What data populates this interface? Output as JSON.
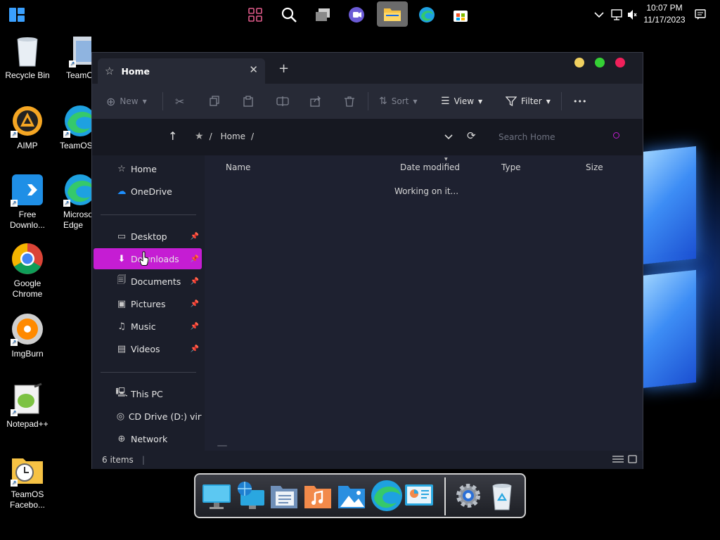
{
  "topbar": {
    "taskbar_icons": [
      "start-icon",
      "widgets-icon",
      "search-icon",
      "task-view-icon",
      "chat-icon",
      "file-explorer-icon",
      "edge-icon",
      "store-icon"
    ],
    "clock_time": "10:07 PM",
    "clock_date": "11/17/2023"
  },
  "desktop": {
    "icons": [
      {
        "label": "Recycle Bin",
        "icon": "recycle-bin-icon"
      },
      {
        "label": "TeamO",
        "icon": "teamos-icon"
      },
      {
        "label": "AIMP",
        "icon": "aimp-icon"
      },
      {
        "label": "TeamOS",
        "icon": "teamos-edge-icon"
      },
      {
        "label": "Free Downlo...",
        "icon": "free-download-manager-icon"
      },
      {
        "label": "Microso Edge",
        "icon": "edge-icon"
      },
      {
        "label": "Google Chrome",
        "icon": "chrome-icon"
      },
      {
        "label": "ImgBurn",
        "icon": "imgburn-icon"
      },
      {
        "label": "Notepad++",
        "icon": "notepadpp-icon"
      },
      {
        "label": "TeamOS Facebo...",
        "icon": "folder-clock-icon"
      }
    ]
  },
  "explorer": {
    "tab_title": "Home",
    "new_tab_glyph": "+",
    "toolbar": {
      "new_label": "New",
      "sort_label": "Sort",
      "view_label": "View",
      "filter_label": "Filter",
      "more_glyph": "•••"
    },
    "breadcrumb": {
      "root_glyph": "/",
      "location": "Home",
      "trailing_sep": "/"
    },
    "search_placeholder": "Search Home",
    "nav": {
      "top": [
        {
          "label": "Home",
          "icon": "star-icon"
        },
        {
          "label": "OneDrive",
          "icon": "cloud-icon"
        }
      ],
      "pinned": [
        {
          "label": "Desktop",
          "icon": "desktop-icon"
        },
        {
          "label": "Downloads",
          "icon": "download-icon"
        },
        {
          "label": "Documents",
          "icon": "documents-icon"
        },
        {
          "label": "Pictures",
          "icon": "pictures-icon"
        },
        {
          "label": "Music",
          "icon": "music-icon"
        },
        {
          "label": "Videos",
          "icon": "videos-icon"
        }
      ],
      "bottom": [
        {
          "label": "This PC",
          "icon": "pc-icon"
        },
        {
          "label": "CD Drive (D:) virtio-",
          "icon": "cd-drive-icon"
        },
        {
          "label": "Network",
          "icon": "network-icon"
        }
      ],
      "selected": "Downloads"
    },
    "columns": [
      "Name",
      "Date modified",
      "Type",
      "Size"
    ],
    "status_message": "Working on it...",
    "status_bar": {
      "item_count": "6 items",
      "separator": "|"
    },
    "colors": {
      "selected": "#c51dd3",
      "minimize": "#f0d060",
      "maximize": "#35d035",
      "close": "#f0205a"
    }
  },
  "dock": {
    "items": [
      "monitor-icon",
      "network-globe-icon",
      "files-icon",
      "music-folder-icon",
      "photos-icon",
      "edge-icon",
      "system-monitor-icon",
      "settings-gear-icon",
      "recycle-bin-icon"
    ]
  }
}
